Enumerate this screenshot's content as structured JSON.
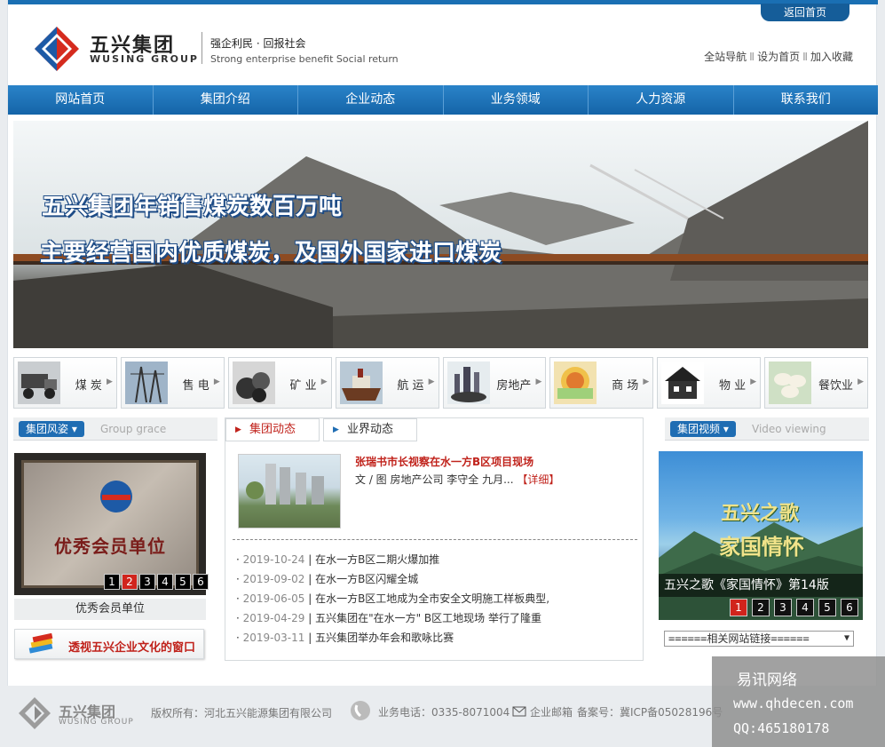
{
  "header": {
    "home_tab": "返回首页",
    "logo_cn": "五兴集团",
    "logo_en": "WUSING GROUP",
    "slogan_cn": "强企利民 · 回报社会",
    "slogan_en": "Strong enterprise benefit Social return",
    "links": [
      "全站导航",
      "设为首页",
      "加入收藏"
    ]
  },
  "nav": [
    "网站首页",
    "集团介绍",
    "企业动态",
    "业务领域",
    "人力资源",
    "联系我们"
  ],
  "banner": {
    "line1": "五兴集团年销售煤炭数百万吨",
    "line2": "主要经营国内优质煤炭，及国外国家进口煤炭"
  },
  "categories": [
    {
      "label": "煤 炭",
      "icon": "truck-icon"
    },
    {
      "label": "售 电",
      "icon": "power-tower-icon"
    },
    {
      "label": "矿 业",
      "icon": "ore-icon"
    },
    {
      "label": "航 运",
      "icon": "ship-icon"
    },
    {
      "label": "房地产",
      "icon": "city-icon"
    },
    {
      "label": "商 场",
      "icon": "sale-icon"
    },
    {
      "label": "物 业",
      "icon": "house-icon"
    },
    {
      "label": "餐饮业",
      "icon": "dumpling-icon"
    }
  ],
  "grace": {
    "title": "集团风姿",
    "title_en": "Group grace",
    "image_text": "优秀会员单位",
    "pages": [
      "1",
      "2",
      "3",
      "4",
      "5",
      "6"
    ],
    "active_page": "2",
    "caption": "优秀会员单位",
    "culture_link": "透视五兴企业文化的窗口"
  },
  "news": {
    "tabs": [
      "集团动态",
      "业界动态"
    ],
    "featured_title": "张瑞书市长视察在水一方B区项目现场",
    "featured_summary": "文 / 图  房地产公司  李守全 九月...",
    "featured_more": "【详细】",
    "items": [
      {
        "date": "2019-10-24",
        "title": "在水一方B区二期火爆加推"
      },
      {
        "date": "2019-09-02",
        "title": "在水一方B区闪耀全城"
      },
      {
        "date": "2019-06-05",
        "title": "在水一方B区工地成为全市安全文明施工样板典型,"
      },
      {
        "date": "2019-04-29",
        "title": "五兴集团在\"在水一方\" B区工地现场 举行了隆重"
      },
      {
        "date": "2019-03-11",
        "title": "五兴集团举办年会和歌咏比赛"
      }
    ]
  },
  "video": {
    "title": "集团视频",
    "title_en": "Video viewing",
    "image_text1": "五兴之歌",
    "image_text2": "家国情怀",
    "caption": "五兴之歌《家国情怀》第14版",
    "pages": [
      "1",
      "2",
      "3",
      "4",
      "5",
      "6"
    ],
    "active_page": "1",
    "select_value": "======相关网站链接======"
  },
  "footer": {
    "logo_cn": "五兴集团",
    "logo_en": "WUSING GROUP",
    "copyright": "版权所有：河北五兴能源集团有限公司",
    "tel": "业务电话：0335-8071004",
    "mail": "企业邮箱",
    "icp": "备案号：冀ICP备05028196号"
  },
  "watermark": {
    "line1": "易讯网络",
    "line2": "www.qhdecen.com",
    "line3": "QQ:465180178"
  }
}
